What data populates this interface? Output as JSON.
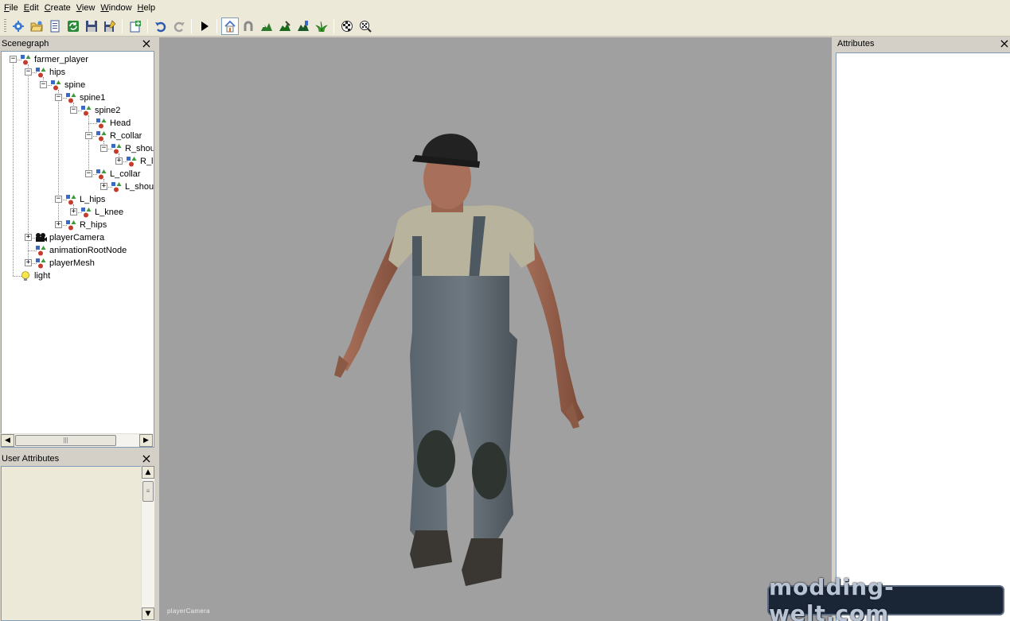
{
  "menu": {
    "items": [
      {
        "label": "File",
        "mnemonic": "F",
        "rest": "ile"
      },
      {
        "label": "Edit",
        "mnemonic": "E",
        "rest": "dit"
      },
      {
        "label": "Create",
        "mnemonic": "C",
        "rest": "reate"
      },
      {
        "label": "View",
        "mnemonic": "V",
        "rest": "iew"
      },
      {
        "label": "Window",
        "mnemonic": "W",
        "rest": "indow"
      },
      {
        "label": "Help",
        "mnemonic": "H",
        "rest": "elp"
      }
    ]
  },
  "toolbar": {
    "buttons": [
      {
        "icon": "new-scene-icon"
      },
      {
        "icon": "open-folder-icon"
      },
      {
        "icon": "document-list-icon"
      },
      {
        "icon": "refresh-icon"
      },
      {
        "icon": "save-icon"
      },
      {
        "icon": "save-as-icon"
      },
      {
        "icon": "import-icon"
      },
      {
        "icon": "undo-icon"
      },
      {
        "icon": "redo-icon"
      },
      {
        "icon": "play-icon"
      },
      {
        "icon": "home-icon"
      },
      {
        "icon": "magnet-icon"
      },
      {
        "icon": "terrain-icon"
      },
      {
        "icon": "terrain-paint-icon"
      },
      {
        "icon": "terrain-edit-icon"
      },
      {
        "icon": "foliage-icon"
      },
      {
        "icon": "checker-icon"
      },
      {
        "icon": "checker-zoom-icon"
      }
    ]
  },
  "scenegraph": {
    "title": "Scenegraph",
    "nodes": [
      {
        "label": "farmer_player",
        "level": 0,
        "expander": "minus",
        "icon": "transform-node-icon"
      },
      {
        "label": "hips",
        "level": 1,
        "expander": "minus",
        "icon": "transform-node-icon"
      },
      {
        "label": "spine",
        "level": 2,
        "expander": "minus",
        "icon": "transform-node-icon"
      },
      {
        "label": "spine1",
        "level": 3,
        "expander": "minus",
        "icon": "transform-node-icon"
      },
      {
        "label": "spine2",
        "level": 4,
        "expander": "minus",
        "icon": "transform-node-icon"
      },
      {
        "label": "Head",
        "level": 5,
        "expander": "none",
        "icon": "transform-node-icon"
      },
      {
        "label": "R_collar",
        "level": 5,
        "expander": "minus",
        "icon": "transform-node-icon"
      },
      {
        "label": "R_shou",
        "level": 6,
        "expander": "minus",
        "icon": "transform-node-icon"
      },
      {
        "label": "R_l",
        "level": 7,
        "expander": "plus",
        "icon": "transform-node-icon"
      },
      {
        "label": "L_collar",
        "level": 5,
        "expander": "minus",
        "icon": "transform-node-icon"
      },
      {
        "label": "L_shou",
        "level": 6,
        "expander": "plus",
        "icon": "transform-node-icon"
      },
      {
        "label": "L_hips",
        "level": 3,
        "expander": "minus",
        "icon": "transform-node-icon"
      },
      {
        "label": "L_knee",
        "level": 4,
        "expander": "plus",
        "icon": "transform-node-icon"
      },
      {
        "label": "R_hips",
        "level": 3,
        "expander": "plus",
        "icon": "transform-node-icon"
      },
      {
        "label": "playerCamera",
        "level": 1,
        "expander": "plus",
        "icon": "camera-icon"
      },
      {
        "label": "animationRootNode",
        "level": 1,
        "expander": "none",
        "icon": "transform-node-icon"
      },
      {
        "label": "playerMesh",
        "level": 1,
        "expander": "plus",
        "icon": "transform-node-icon"
      },
      {
        "label": "light",
        "level": 0,
        "expander": "none",
        "icon": "light-bulb-icon"
      }
    ]
  },
  "user_attributes": {
    "title": "User Attributes"
  },
  "attributes": {
    "title": "Attributes"
  },
  "viewport": {
    "camera_label": "playerCamera"
  },
  "watermark": {
    "text": "modding-welt.com"
  },
  "colors": {
    "menu_bg": "#ece9d8",
    "viewport_bg": "#a0a0a0",
    "panel_border": "#7f9db9"
  }
}
